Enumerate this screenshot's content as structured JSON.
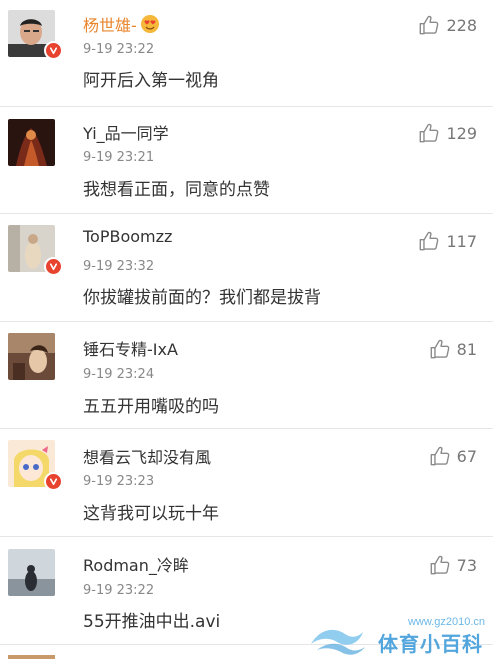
{
  "comments": [
    {
      "user": "杨世雄-",
      "time": "9-19 23:22",
      "text": "阿开后入第一视角",
      "likes": "228"
    },
    {
      "user": "Yi_品一同学",
      "time": "9-19 23:21",
      "text": "我想看正面，同意的点赞",
      "likes": "129"
    },
    {
      "user": "ToPBoomzz",
      "time": "9-19 23:32",
      "text": "你拔罐拔前面的？我们都是拔背",
      "likes": "117"
    },
    {
      "user": "锤石专精-IxA",
      "time": "9-19 23:24",
      "text": "五五开用嘴吸的吗",
      "likes": "81"
    },
    {
      "user": "想看云飞却没有風",
      "time": "9-19 23:23",
      "text": "这背我可以玩十年",
      "likes": "67"
    },
    {
      "user": "Rodman_冷眸",
      "time": "9-19 23:22",
      "text": "55开推油中出.avi",
      "likes": "73"
    }
  ],
  "watermark": {
    "url": "www.gz2010.cn",
    "title": "体育小百科"
  },
  "icons": {
    "like": "thumbs-up-icon",
    "verified": "verified-badge-icon",
    "emoji": "heart-eyes-emoji-icon"
  },
  "colors": {
    "vip_name": "#e8862e",
    "badge": "#e8432f",
    "watermark": "#52a6dd"
  }
}
